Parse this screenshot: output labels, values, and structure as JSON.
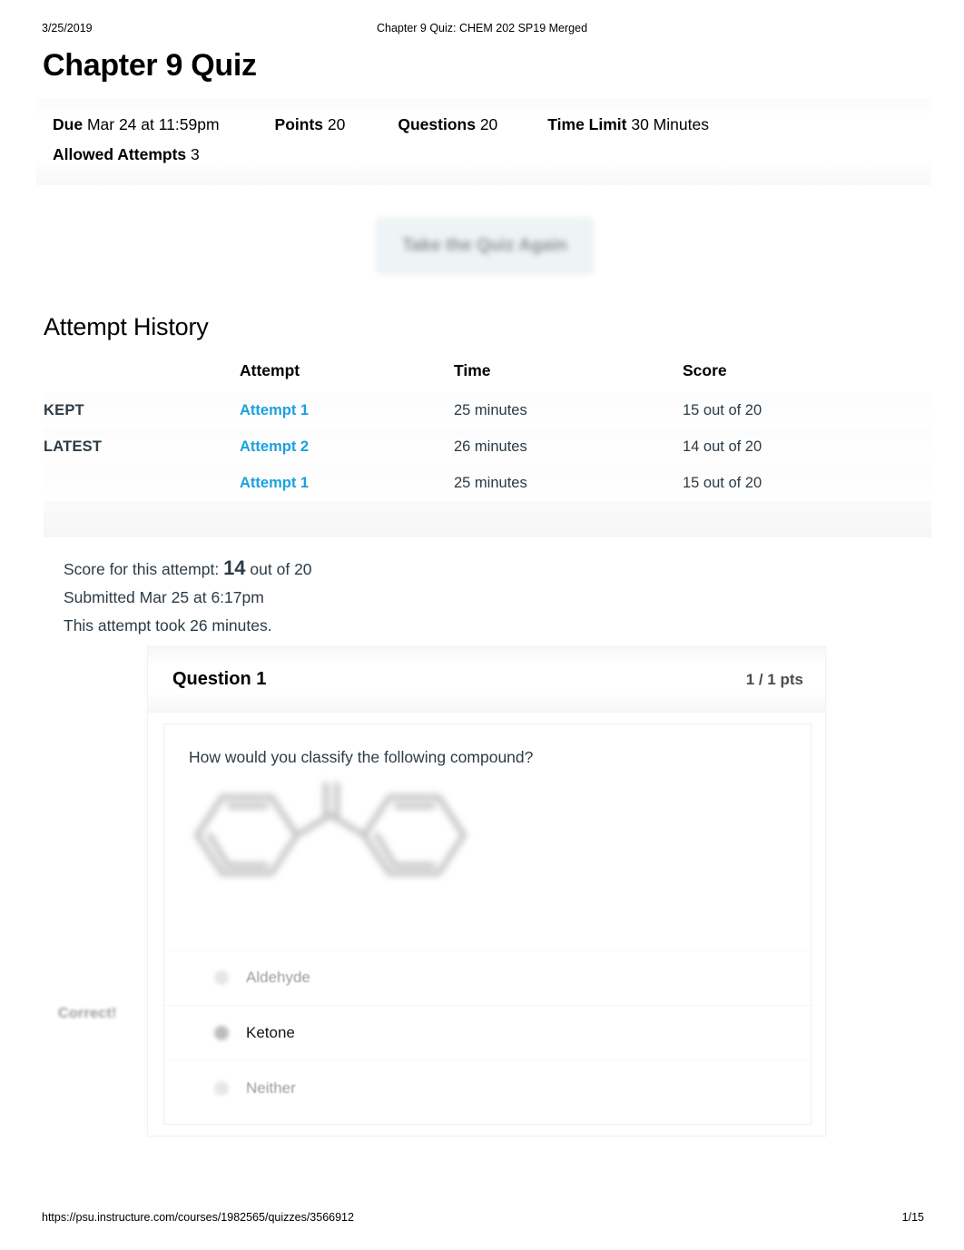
{
  "print_header": {
    "date": "3/25/2019",
    "title": "Chapter 9 Quiz: CHEM 202 SP19 Merged"
  },
  "quiz": {
    "title": "Chapter 9 Quiz",
    "meta": {
      "due_label": "Due",
      "due_value": "Mar 24 at 11:59pm",
      "points_label": "Points",
      "points_value": "20",
      "questions_label": "Questions",
      "questions_value": "20",
      "time_limit_label": "Time Limit",
      "time_limit_value": "30 Minutes",
      "allowed_attempts_label": "Allowed Attempts",
      "allowed_attempts_value": "3"
    }
  },
  "retake_button": {
    "label": "Take the Quiz Again"
  },
  "attempt_history": {
    "heading": "Attempt History",
    "columns": [
      "",
      "Attempt",
      "Time",
      "Score"
    ],
    "rows": [
      {
        "status": "KEPT",
        "attempt": "Attempt 1",
        "time": "25 minutes",
        "score": "15 out of 20"
      },
      {
        "status": "LATEST",
        "attempt": "Attempt 2",
        "time": "26 minutes",
        "score": "14 out of 20"
      },
      {
        "status": "",
        "attempt": "Attempt 1",
        "time": "25 minutes",
        "score": "15 out of 20"
      }
    ]
  },
  "score_summary": {
    "score_prefix": "Score for this attempt:",
    "score_value": "14",
    "score_suffix": "out of 20",
    "submitted": "Submitted Mar 25 at 6:17pm",
    "duration": "This attempt took 26 minutes."
  },
  "question": {
    "number_label": "Question 1",
    "points": "1 / 1 pts",
    "prompt": "How would you classify the following compound?",
    "structure_alt": "benzophenone-skeletal-structure",
    "correct_flag": "Correct!",
    "options": [
      {
        "label": "Aldehyde",
        "selected": false
      },
      {
        "label": "Ketone",
        "selected": true
      },
      {
        "label": "Neither",
        "selected": false
      }
    ]
  },
  "footer": {
    "url": "https://psu.instructure.com/courses/1982565/quizzes/3566912",
    "page": "1/15"
  },
  "colors": {
    "link": "#1ba0e0",
    "text": "#2d3b45",
    "muted": "#9b9b9b"
  }
}
